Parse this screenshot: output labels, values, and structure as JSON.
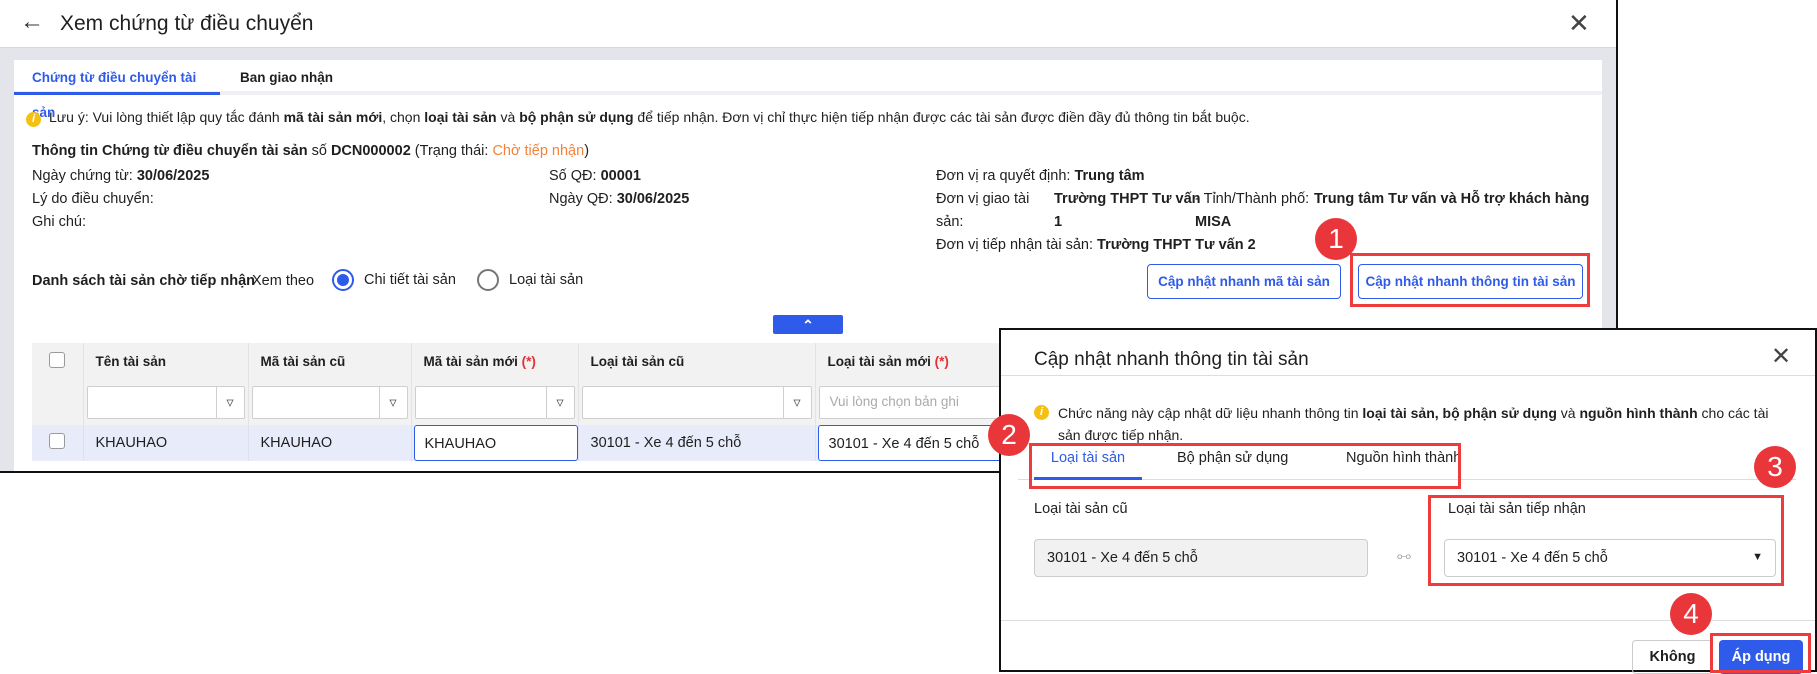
{
  "window": {
    "title": "Xem chứng từ điều chuyển",
    "back_icon": "arrow-left-icon",
    "close_icon": "close-icon"
  },
  "tabs": [
    {
      "label": "Chứng từ điều chuyển tài sản",
      "active": true
    },
    {
      "label": "Ban giao nhận",
      "active": false
    }
  ],
  "notice": {
    "p1": "Lưu ý: Vui lòng thiết lập quy tắc đánh ",
    "b1": "mã tài sản mới",
    "p2": ", chọn ",
    "b2": "loại tài sản",
    "p3": " và ",
    "b3": "bộ phận sử dụng",
    "p4": " để tiếp nhận. Đơn vị chỉ thực hiện tiếp nhận được các tài sản được điền đầy đủ thông tin bắt buộc."
  },
  "info": {
    "heading": "Thông tin Chứng từ điều chuyển tài sản",
    "so_label": "số",
    "so_value": "DCN000002",
    "status_prefix": "(Trạng thái: ",
    "status": "Chờ tiếp nhận",
    "status_suffix": ")",
    "status_color": "#f5823b",
    "ngay_ct_label": "Ngày chứng từ:",
    "ngay_ct": "30/06/2025",
    "ly_do_label": "Lý do điều chuyển:",
    "ghi_chu_label": "Ghi chú:",
    "so_qd_label": "Số QĐ:",
    "so_qd": "00001",
    "ngay_qd_label": "Ngày QĐ:",
    "ngay_qd": "30/06/2025",
    "dv_qd_label": "Đơn vị ra quyết định:",
    "dv_qd": "Trung tâm",
    "dv_giao_label1": "Đơn vị giao tài",
    "dv_giao_label2": "sản:",
    "dv_giao1": "Trường THPT Tư vấn",
    "dv_giao2": "1",
    "tinh_label": "- Tỉnh/Thành phố:",
    "tinh1": "Trung tâm Tư vấn và Hỗ trợ khách hàng",
    "tinh2": "MISA",
    "dv_nhan_label": "Đơn vị tiếp nhận tài sản:",
    "dv_nhan": "Trường THPT Tư vấn 2"
  },
  "list": {
    "title": "Danh sách tài sản chờ tiếp nhận",
    "view_by": "Xem theo",
    "radio1": "Chi tiết tài sản",
    "radio2": "Loại tài sản",
    "btn_ma": "Cập nhật nhanh mã tài sản",
    "btn_info": "Cập nhật nhanh thông tin tài sản"
  },
  "table": {
    "headers": [
      "Tên tài sản",
      "Mã tài sản cũ",
      "Mã tài sản mới",
      "Loại tài sản cũ",
      "Loại tài sản mới"
    ],
    "required_mark": "(*)",
    "filter_placeholder": "Vui lòng chọn bản ghi",
    "rows": [
      {
        "ten": "KHAUHAO",
        "ma_cu": "KHAUHAO",
        "ma_moi": "KHAUHAO",
        "loai_cu": "30101 - Xe 4 đến 5 chỗ",
        "loai_moi": "30101 - Xe 4 đến 5 chỗ"
      }
    ]
  },
  "dialog": {
    "title": "Cập nhật nhanh thông tin tài sản",
    "notice_p1": "Chức năng này cập nhật dữ liệu nhanh thông tin ",
    "notice_b1": "loại tài sản, bộ phận sử dụng",
    "notice_p2": " và ",
    "notice_b2": "nguồn hình thành",
    "notice_p3": " cho các tài sản được tiếp nhận.",
    "tabs": [
      "Loại tài sản",
      "Bộ phận sử dụng",
      "Nguồn hình thành"
    ],
    "old_label": "Loại tài sản cũ",
    "old_value": "30101 - Xe 4 đến 5 chỗ",
    "new_label": "Loại tài sản tiếp nhận",
    "new_value": "30101 - Xe 4 đến 5 chỗ",
    "cancel": "Không",
    "apply": "Áp dụng"
  },
  "badges": [
    "1",
    "2",
    "3",
    "4"
  ],
  "colors": {
    "primary": "#2f5bea",
    "highlight": "#ee3c3c",
    "row": "#e8ebfa"
  }
}
